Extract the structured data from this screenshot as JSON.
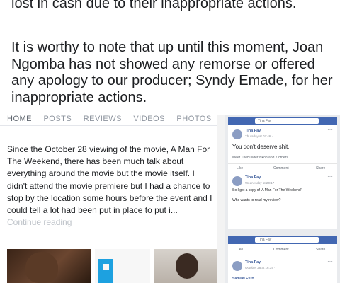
{
  "post": {
    "line_top": "lost in cash due to their inappropriate actions.",
    "paragraph": "It is worthy to note that up until this moment, Joan Ngomba has not showed any remorse or offered any apology to our producer; Syndy Emade, for her inappropriate actions."
  },
  "left_screenshot": {
    "tabs": [
      "HOME",
      "POSTS",
      "REVIEWS",
      "VIDEOS",
      "PHOTOS"
    ],
    "review_text": "Since the October 28 viewing of the movie, A Man For The Weekend, there has been much talk about everything around the movie but the movie itself. I didn't attend the movie premiere but I had a chance to stop by the location some hours before the event and I could tell a lot had been put in place to put i...",
    "continue_reading": "Continue reading"
  },
  "right_screenshot": {
    "card1": {
      "search_placeholder": "Tina Fay",
      "author": "Tina Fay",
      "date": "Thursday at 07:46 · ",
      "comment": "You don't deserve shit.",
      "reactions": "Meet TheBuilder Nkoh and 7 others",
      "like": "Like",
      "comment_btn": "Comment",
      "share": "Share",
      "author2": "Tina Fay",
      "date2": "Wednesday at 20:17 · ",
      "text2": "So I got a copy of 'A Man For The Weekend'",
      "text3": "Who wants to read my review?"
    },
    "card2": {
      "search_placeholder": "Tina Fay",
      "like": "Like",
      "comment_btn": "Comment",
      "share": "Share",
      "author": "Tina Fay",
      "date": "October 28 at 16:34 · ",
      "commenter": "Samuel Etiro"
    }
  },
  "colors": {
    "facebook_blue": "#4267b2",
    "link": "#385898"
  }
}
